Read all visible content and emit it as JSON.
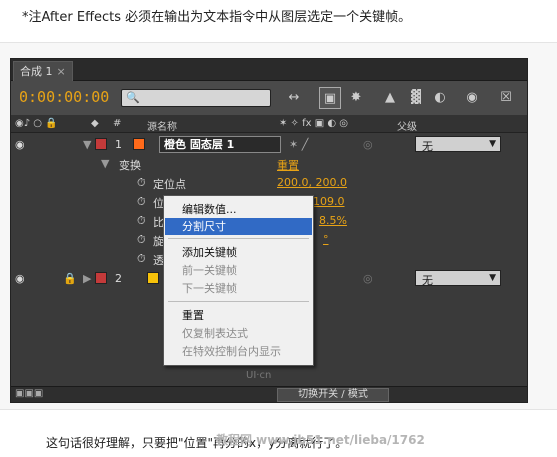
{
  "note": "*注After Effects 必须在输出为文本指令中从图层选定一个关键帧。",
  "panel": {
    "tab_label": "合成 1",
    "tab_close": "×",
    "timecode": "0:00:00:00"
  },
  "columns": {
    "number": "#",
    "source_name": "源名称",
    "parent": "父级"
  },
  "layers": [
    {
      "number": "1",
      "name": "橙色 固态层 1",
      "parent": "无",
      "color": "#ff6a1a",
      "label_color": "#c43a3a"
    },
    {
      "number": "2",
      "name": "",
      "parent": "无",
      "color": "#f7c20a",
      "label_color": "#c43a3a"
    }
  ],
  "transform": {
    "group_label": "变换",
    "reset_label": "重置",
    "properties": [
      {
        "name": "定位点",
        "value": "200.0, 200.0"
      },
      {
        "name": "位置",
        "value": "109.0"
      },
      {
        "name": "比",
        "value": "8.5%"
      },
      {
        "name": "旋",
        "value": "°"
      },
      {
        "name": "透",
        "value": ""
      }
    ]
  },
  "context_menu": {
    "items": [
      {
        "label": "编辑数值...",
        "state": "normal"
      },
      {
        "label": "分割尺寸",
        "state": "highlighted"
      },
      {
        "label": "添加关键帧",
        "state": "normal"
      },
      {
        "label": "前一关键帧",
        "state": "disabled"
      },
      {
        "label": "下一关键帧",
        "state": "disabled"
      },
      {
        "label": "重置",
        "state": "normal"
      },
      {
        "label": "仅复制表达式",
        "state": "disabled"
      },
      {
        "label": "在特效控制台内显示",
        "state": "disabled"
      }
    ]
  },
  "bottom": {
    "toggle_label": "切换开关 / 模式"
  },
  "watermark": "UI·cn",
  "caption": "这句话很好理解，只要把\"位置\"再分的x，y分离就行了。",
  "caption_watermark": "教程网 www.jb51.net/lieba/1762"
}
